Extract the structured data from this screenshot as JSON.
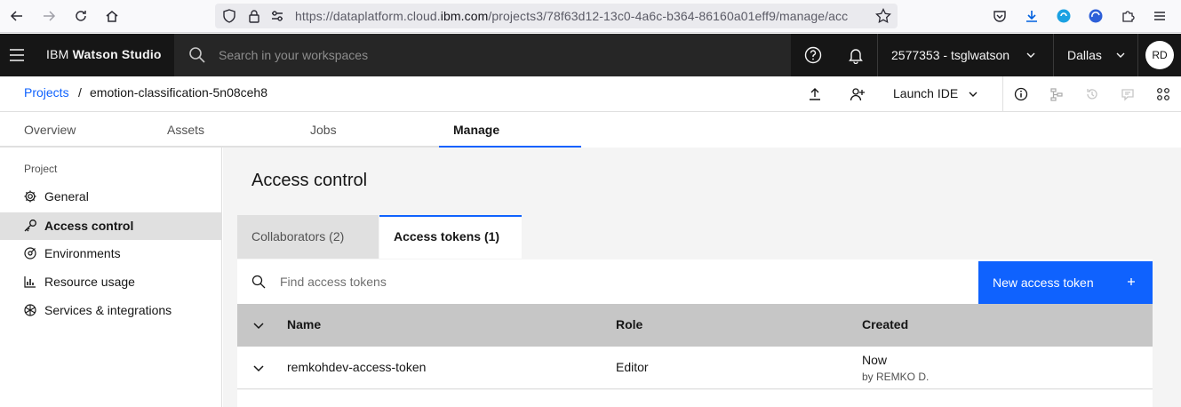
{
  "browser": {
    "url_prefix": "https://dataplatform.cloud.",
    "url_domain": "ibm.com",
    "url_path": "/projects3/78f63d12-13c0-4a6c-b364-86160a01eff9/manage/acc"
  },
  "header": {
    "brand_plain": "IBM ",
    "brand_bold": "Watson Studio",
    "search_placeholder": "Search in your workspaces",
    "account": "2577353 - tsglwatson",
    "region": "Dallas",
    "avatar": "RD"
  },
  "breadcrumb": {
    "root": "Projects",
    "separator": "/",
    "current": "emotion-classification-5n08ceh8",
    "launch_label": "Launch IDE"
  },
  "tabs": [
    {
      "label": "Overview"
    },
    {
      "label": "Assets"
    },
    {
      "label": "Jobs"
    },
    {
      "label": "Manage"
    }
  ],
  "sidebar": {
    "heading": "Project",
    "items": [
      {
        "label": "General",
        "icon": "gear-icon"
      },
      {
        "label": "Access control",
        "icon": "key-icon"
      },
      {
        "label": "Environments",
        "icon": "environment-icon"
      },
      {
        "label": "Resource usage",
        "icon": "chart-bar-icon"
      },
      {
        "label": "Services & integrations",
        "icon": "integrations-icon"
      }
    ],
    "active_index": 1
  },
  "main": {
    "title": "Access control",
    "subtabs": [
      {
        "label": "Collaborators (2)"
      },
      {
        "label": "Access tokens (1)"
      }
    ],
    "search_placeholder": "Find access tokens",
    "new_button": "New access token",
    "columns": [
      "Name",
      "Role",
      "Created"
    ],
    "rows": [
      {
        "name": "remkohdev-access-token",
        "role": "Editor",
        "created": "Now",
        "created_by": "by REMKO D."
      }
    ]
  },
  "colors": {
    "accent": "#0f62fe",
    "header_bg": "#161616"
  }
}
